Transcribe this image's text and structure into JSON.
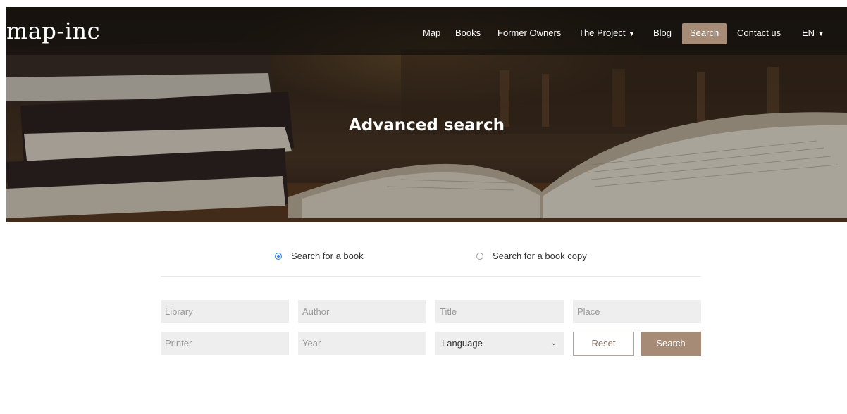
{
  "brand": {
    "logo_text": "map-inc"
  },
  "nav": {
    "items": [
      {
        "label": "Map"
      },
      {
        "label": "Books"
      },
      {
        "label": "Former Owners"
      },
      {
        "label": "The Project"
      },
      {
        "label": "Blog"
      },
      {
        "label": "Search"
      },
      {
        "label": "Contact us"
      },
      {
        "label": "EN"
      }
    ],
    "caret": "▼"
  },
  "hero": {
    "title": "Advanced search"
  },
  "search_mode": {
    "options": [
      {
        "label": "Search for a book",
        "checked": true
      },
      {
        "label": "Search for a book copy",
        "checked": false
      }
    ]
  },
  "form": {
    "library_placeholder": "Library",
    "author_placeholder": "Author",
    "title_placeholder": "Title",
    "place_placeholder": "Place",
    "printer_placeholder": "Printer",
    "year_placeholder": "Year",
    "language_value": "Language",
    "chevron": "⌄",
    "reset_label": "Reset",
    "search_label": "Search"
  },
  "colors": {
    "accent": "#a68b76",
    "radio_checked": "#2b7de9",
    "field_bg": "#eeeeee"
  }
}
